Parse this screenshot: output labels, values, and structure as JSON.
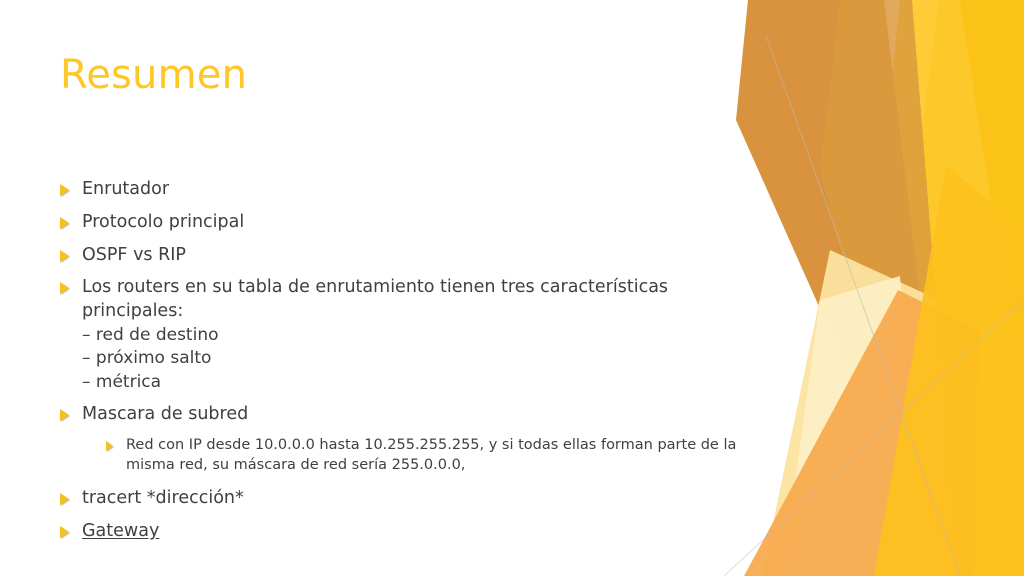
{
  "slide": {
    "title": "Resumen",
    "title_color": "#FFC627",
    "body_text_color": "#404040",
    "background_color": "#FFFFFF",
    "bullet_marker_icon": "triangle-right-icon",
    "bullet_marker_color": "#F5C11E"
  },
  "content": {
    "bullets": [
      {
        "level": 1,
        "text": "Enrutador"
      },
      {
        "level": 1,
        "text": "Protocolo principal"
      },
      {
        "level": 1,
        "text": "OSPF vs RIP"
      },
      {
        "level": 1,
        "text": "Los routers en su tabla de enrutamiento tienen tres características principales:",
        "sublines": [
          "– red de destino",
          "– próximo salto",
          "– métrica"
        ]
      },
      {
        "level": 1,
        "text": "Mascara de subred"
      },
      {
        "level": 2,
        "text": "Red con IP desde 10.0.0.0 hasta 10.255.255.255, y si todas ellas forman parte de la misma red, su máscara de red sería 255.0.0.0,"
      },
      {
        "level": 1,
        "text": "tracert *dirección*"
      },
      {
        "level": 1,
        "text": "Gateway",
        "is_link": true
      }
    ]
  },
  "decoration": {
    "name": "facet-corner-graphic",
    "colors": {
      "bright_yellow": "#FBC317",
      "golden_yellow": "#FDC92B",
      "orange": "#F7A84B",
      "dark_orange": "#D9923D",
      "deep_orange": "#DB9A3E",
      "pale_cream": "#FCE3A0",
      "light_cream": "#FDEFC6",
      "hairline_grey": "#B9B9B9"
    }
  }
}
